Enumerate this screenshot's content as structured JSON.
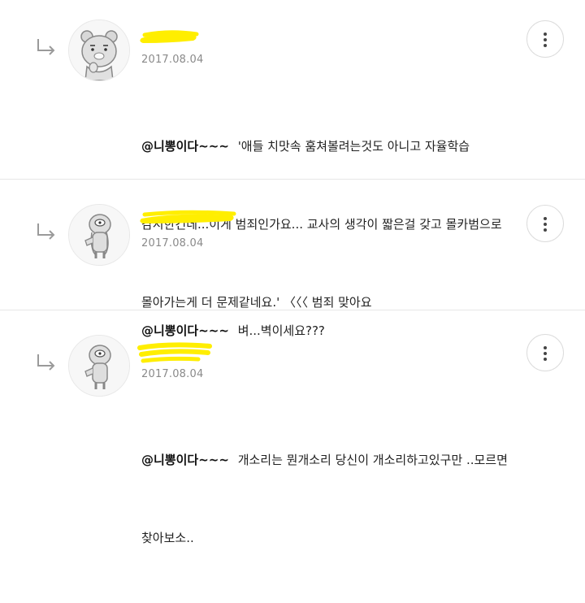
{
  "comments": [
    {
      "date": "2017.08.04",
      "mention": "@니뽕이다~~~",
      "lines": [
        "'애들 치맛속 훔쳐볼려는것도 아니고 자율학습",
        "감시한건데...이게 범죄인가요... 교사의 생각이 짧은걸 갖고 몰카범으로",
        "몰아가는게 더 문제같네요.' 〈〈〈 범죄 맞아요"
      ],
      "avatar": "ryan-icon"
    },
    {
      "date": "2017.08.04",
      "mention": "@니뽕이다~~~",
      "lines": [
        "벼...벽이세요???"
      ],
      "avatar": "character-icon"
    },
    {
      "date": "2017.08.04",
      "mention": "@니뽕이다~~~",
      "lines": [
        "개소리는 뭔개소리 당신이 개소리하고있구만 ..모르면",
        "찾아보소.."
      ],
      "avatar": "character-icon"
    }
  ],
  "colors": {
    "highlight": "#ffee00",
    "divider": "#e6e6e6",
    "date": "#8a8a8a"
  }
}
